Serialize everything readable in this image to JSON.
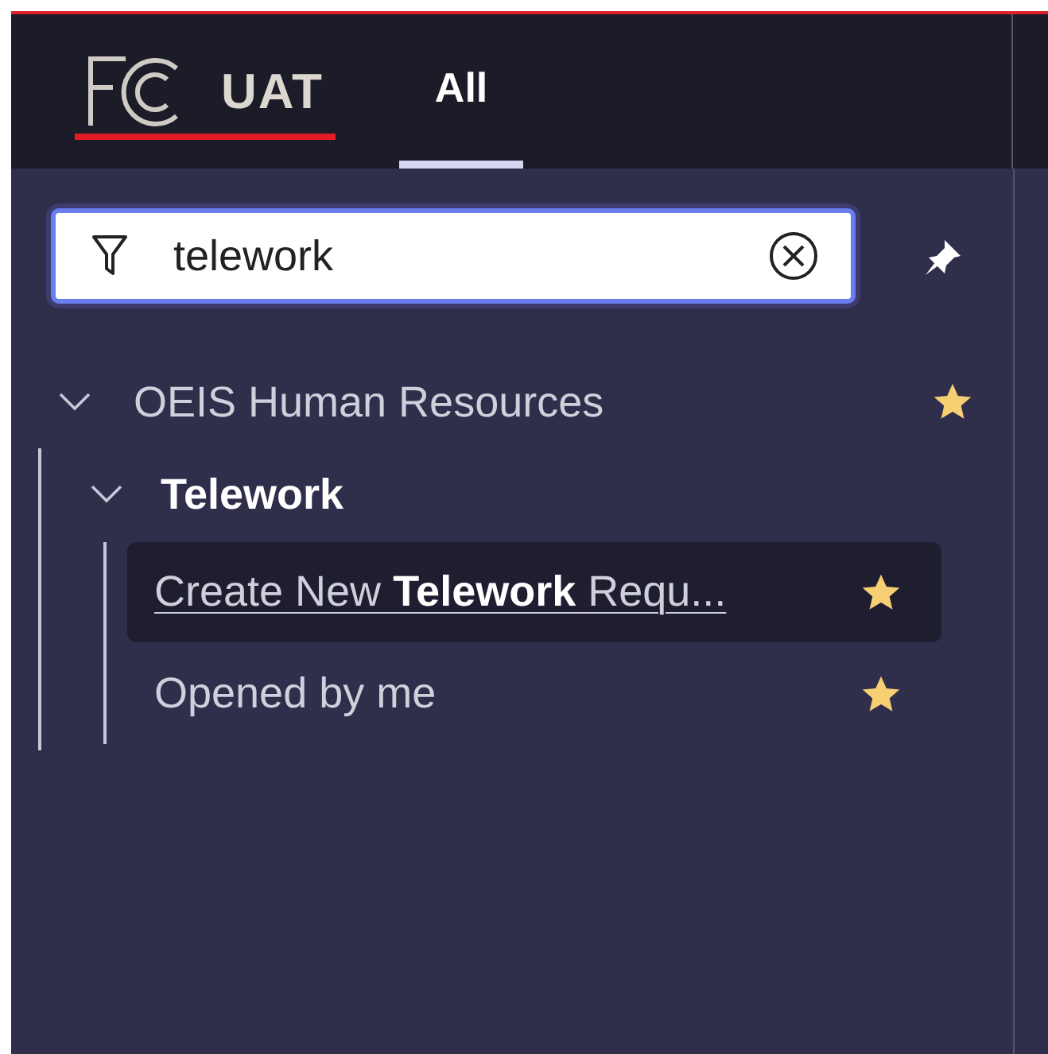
{
  "header": {
    "env_label": "UAT",
    "tabs": [
      {
        "label": "All",
        "selected": true
      }
    ]
  },
  "filter": {
    "value": "telework"
  },
  "tree": [
    {
      "label": "OEIS Human Resources",
      "expanded": true,
      "favorite": true,
      "children": [
        {
          "label": "Telework",
          "expanded": true,
          "children": [
            {
              "label": "Create New **Telework** Requ...",
              "favorite": true,
              "highlighted": true
            },
            {
              "label": "Opened by me",
              "favorite": true,
              "highlighted": false
            }
          ]
        }
      ]
    }
  ]
}
